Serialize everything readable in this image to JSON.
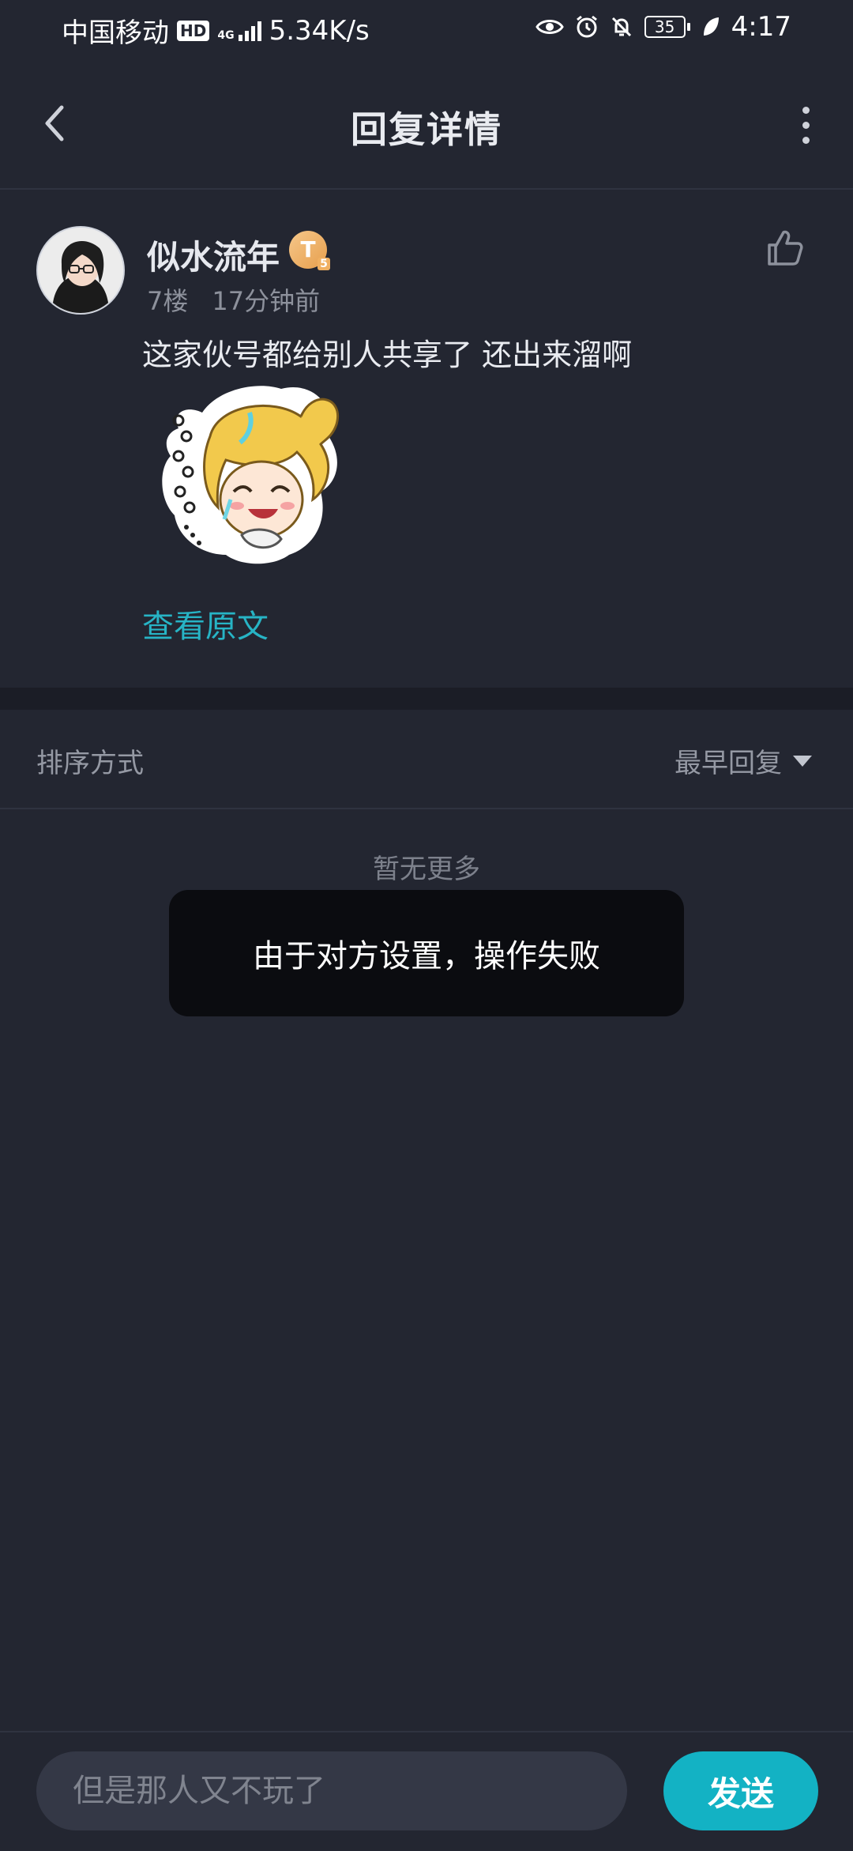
{
  "status_bar": {
    "carrier": "中国移动",
    "hd": "HD",
    "network": "4G",
    "speed": "5.34K/s",
    "battery": "35",
    "time": "4:17"
  },
  "header": {
    "title": "回复详情"
  },
  "post": {
    "username": "似水流年",
    "level_badge": "T",
    "level_badge_sub": "5",
    "floor": "7楼",
    "time_ago": "17分钟前",
    "content": "这家伙号都给别人共享了 还出来溜啊",
    "sticker_icon": "anime-girl-sticker",
    "view_original": "查看原文"
  },
  "sort": {
    "label": "排序方式",
    "selected": "最早回复"
  },
  "no_more": "暂无更多",
  "toast": {
    "message": "由于对方设置，操作失败"
  },
  "reply": {
    "placeholder": "但是那人又不玩了",
    "send_label": "发送"
  },
  "colors": {
    "background": "#232631",
    "accent": "#13b2c4",
    "link": "#27b4c5"
  }
}
